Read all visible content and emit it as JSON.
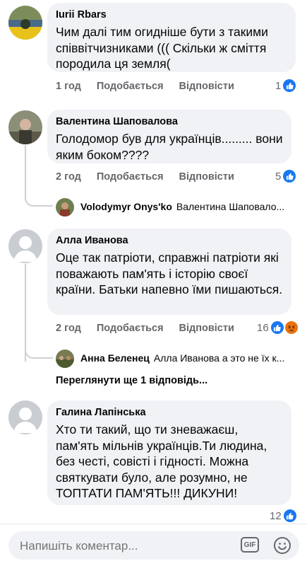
{
  "comments": [
    {
      "author": "Iurii Rbars",
      "text": "Чим далі тим огидніше бути з такими співвітчизниками ((( Скільки ж сміття породила ця земля(",
      "time": "1 год",
      "like_label": "Подобається",
      "reply_label": "Відповісти",
      "reaction_count": "1",
      "reactions": [
        "like-icon"
      ]
    },
    {
      "author": "Валентина Шаповалова",
      "text": "Голодомор був для українців......... вони яким боком????",
      "time": "2 год",
      "like_label": "Подобається",
      "reply_label": "Відповісти",
      "reaction_count": "5",
      "reactions": [
        "like-icon"
      ],
      "reply": {
        "author": "Volodymyr  Onys'ko",
        "text": "Валентина Шаповало..."
      }
    },
    {
      "author": "Алла Иванова",
      "text": "Оце так патріоти, справжні патріоти які поважають пам'ять і історію своєї країни. Батьки напевно їми пишаються.",
      "time": "2 год",
      "like_label": "Подобається",
      "reply_label": "Відповісти",
      "reaction_count": "16",
      "reactions": [
        "like-icon",
        "angry-icon"
      ],
      "reply": {
        "author": "Анна Беленец",
        "text": "Алла Иванова  а это не їх к..."
      },
      "more_replies": "Переглянути ще 1 відповідь..."
    },
    {
      "author": "Галина Лапінська",
      "text": "Хто ти такий, що ти зневажаєш, пам'ять мільнів українців.Ти людина, без честі, совісті і гідності. Можна святкувати було, але розумно, не ТОПТАТИ ПАМ'ЯТЬ!!! ДИКУНИ!",
      "time": "",
      "like_label": "",
      "reply_label": "",
      "reaction_count": "12",
      "reactions": [
        "like-icon"
      ]
    }
  ],
  "composer": {
    "placeholder": "Напишіть коментар...",
    "gif_label": "GIF"
  },
  "colors": {
    "bubble": "#f0f2f5",
    "meta_gray": "#65676b",
    "like_blue": "#1877f2",
    "angry_yellow": "#f7b125"
  }
}
